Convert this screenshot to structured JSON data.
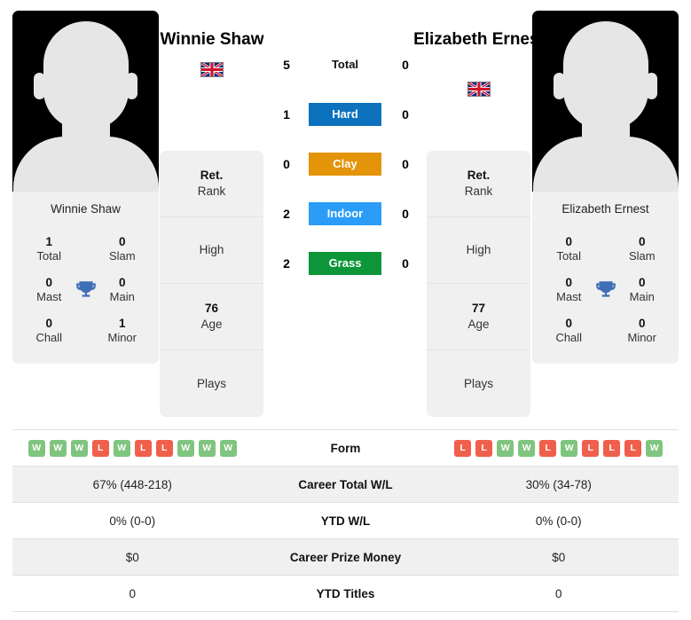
{
  "players": {
    "left": {
      "name": "Winnie Shaw",
      "card_name": "Winnie Shaw",
      "flag": "uk-flag-icon",
      "titles": {
        "total": {
          "value": "1",
          "label": "Total"
        },
        "slam": {
          "value": "0",
          "label": "Slam"
        },
        "mast": {
          "value": "0",
          "label": "Mast"
        },
        "main": {
          "value": "0",
          "label": "Main"
        },
        "chall": {
          "value": "0",
          "label": "Chall"
        },
        "minor": {
          "value": "1",
          "label": "Minor"
        }
      },
      "info": {
        "rank_top": "Ret.",
        "rank_bot": "Rank",
        "high_top": "",
        "high_bot": "High",
        "age_top": "76",
        "age_bot": "Age",
        "plays_top": "",
        "plays_bot": "Plays"
      },
      "surface_counts": {
        "total": "5",
        "hard": "1",
        "clay": "0",
        "indoor": "2",
        "grass": "2"
      },
      "form": [
        "W",
        "W",
        "W",
        "L",
        "W",
        "L",
        "L",
        "W",
        "W",
        "W"
      ],
      "career_total_wl": "67% (448-218)",
      "ytd_wl": "0% (0-0)",
      "career_prize_money": "$0",
      "ytd_titles": "0"
    },
    "right": {
      "name": "Elizabeth Ernest",
      "card_name": "Elizabeth Ernest",
      "flag": "uk-flag-icon",
      "titles": {
        "total": {
          "value": "0",
          "label": "Total"
        },
        "slam": {
          "value": "0",
          "label": "Slam"
        },
        "mast": {
          "value": "0",
          "label": "Mast"
        },
        "main": {
          "value": "0",
          "label": "Main"
        },
        "chall": {
          "value": "0",
          "label": "Chall"
        },
        "minor": {
          "value": "0",
          "label": "Minor"
        }
      },
      "info": {
        "rank_top": "Ret.",
        "rank_bot": "Rank",
        "high_top": "",
        "high_bot": "High",
        "age_top": "77",
        "age_bot": "Age",
        "plays_top": "",
        "plays_bot": "Plays"
      },
      "surface_counts": {
        "total": "0",
        "hard": "0",
        "clay": "0",
        "indoor": "0",
        "grass": "0"
      },
      "form": [
        "L",
        "L",
        "W",
        "W",
        "L",
        "W",
        "L",
        "L",
        "L",
        "W"
      ],
      "career_total_wl": "30% (34-78)",
      "ytd_wl": "0% (0-0)",
      "career_prize_money": "$0",
      "ytd_titles": "0"
    }
  },
  "surfaces": [
    {
      "key": "total",
      "label": "Total",
      "color": "transparent",
      "text_color": "#111111"
    },
    {
      "key": "hard",
      "label": "Hard",
      "color": "#0c72bd",
      "text_color": "#ffffff"
    },
    {
      "key": "clay",
      "label": "Clay",
      "color": "#e39408",
      "text_color": "#ffffff"
    },
    {
      "key": "indoor",
      "label": "Indoor",
      "color": "#2b9cf7",
      "text_color": "#ffffff"
    },
    {
      "key": "grass",
      "label": "Grass",
      "color": "#0d9639",
      "text_color": "#ffffff"
    }
  ],
  "table": {
    "rows": [
      {
        "label": "Form",
        "type": "form"
      },
      {
        "label": "Career Total W/L",
        "type": "text",
        "field": "career_total_wl"
      },
      {
        "label": "YTD W/L",
        "type": "text",
        "field": "ytd_wl"
      },
      {
        "label": "Career Prize Money",
        "type": "text",
        "field": "career_prize_money"
      },
      {
        "label": "YTD Titles",
        "type": "text",
        "field": "ytd_titles"
      }
    ]
  },
  "colors": {
    "win_badge": "#7fc47f",
    "loss_badge": "#ef5f4c",
    "card_bg": "#f0f0f0",
    "trophy": "#3f6fb5",
    "row_alt": "#f0f0f0"
  }
}
